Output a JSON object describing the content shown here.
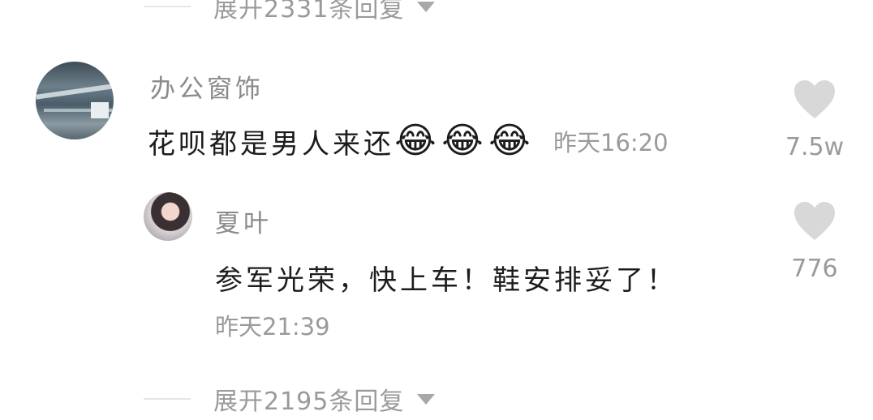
{
  "top_expand": {
    "label": "展开2331条回复"
  },
  "comment": {
    "username": "办公窗饰",
    "text": "花呗都是男人来还",
    "emojis": [
      "😂",
      "😂",
      "😂"
    ],
    "time": "昨天16:20",
    "likes": "7.5w"
  },
  "reply": {
    "username": "夏叶",
    "text": "参军光荣，快上车！鞋安排妥了！",
    "time": "昨天21:39",
    "likes": "776"
  },
  "bottom_expand": {
    "label": "展开2195条回复"
  },
  "colors": {
    "muted": "#9a9a9a",
    "heart": "#d8d8d8"
  }
}
